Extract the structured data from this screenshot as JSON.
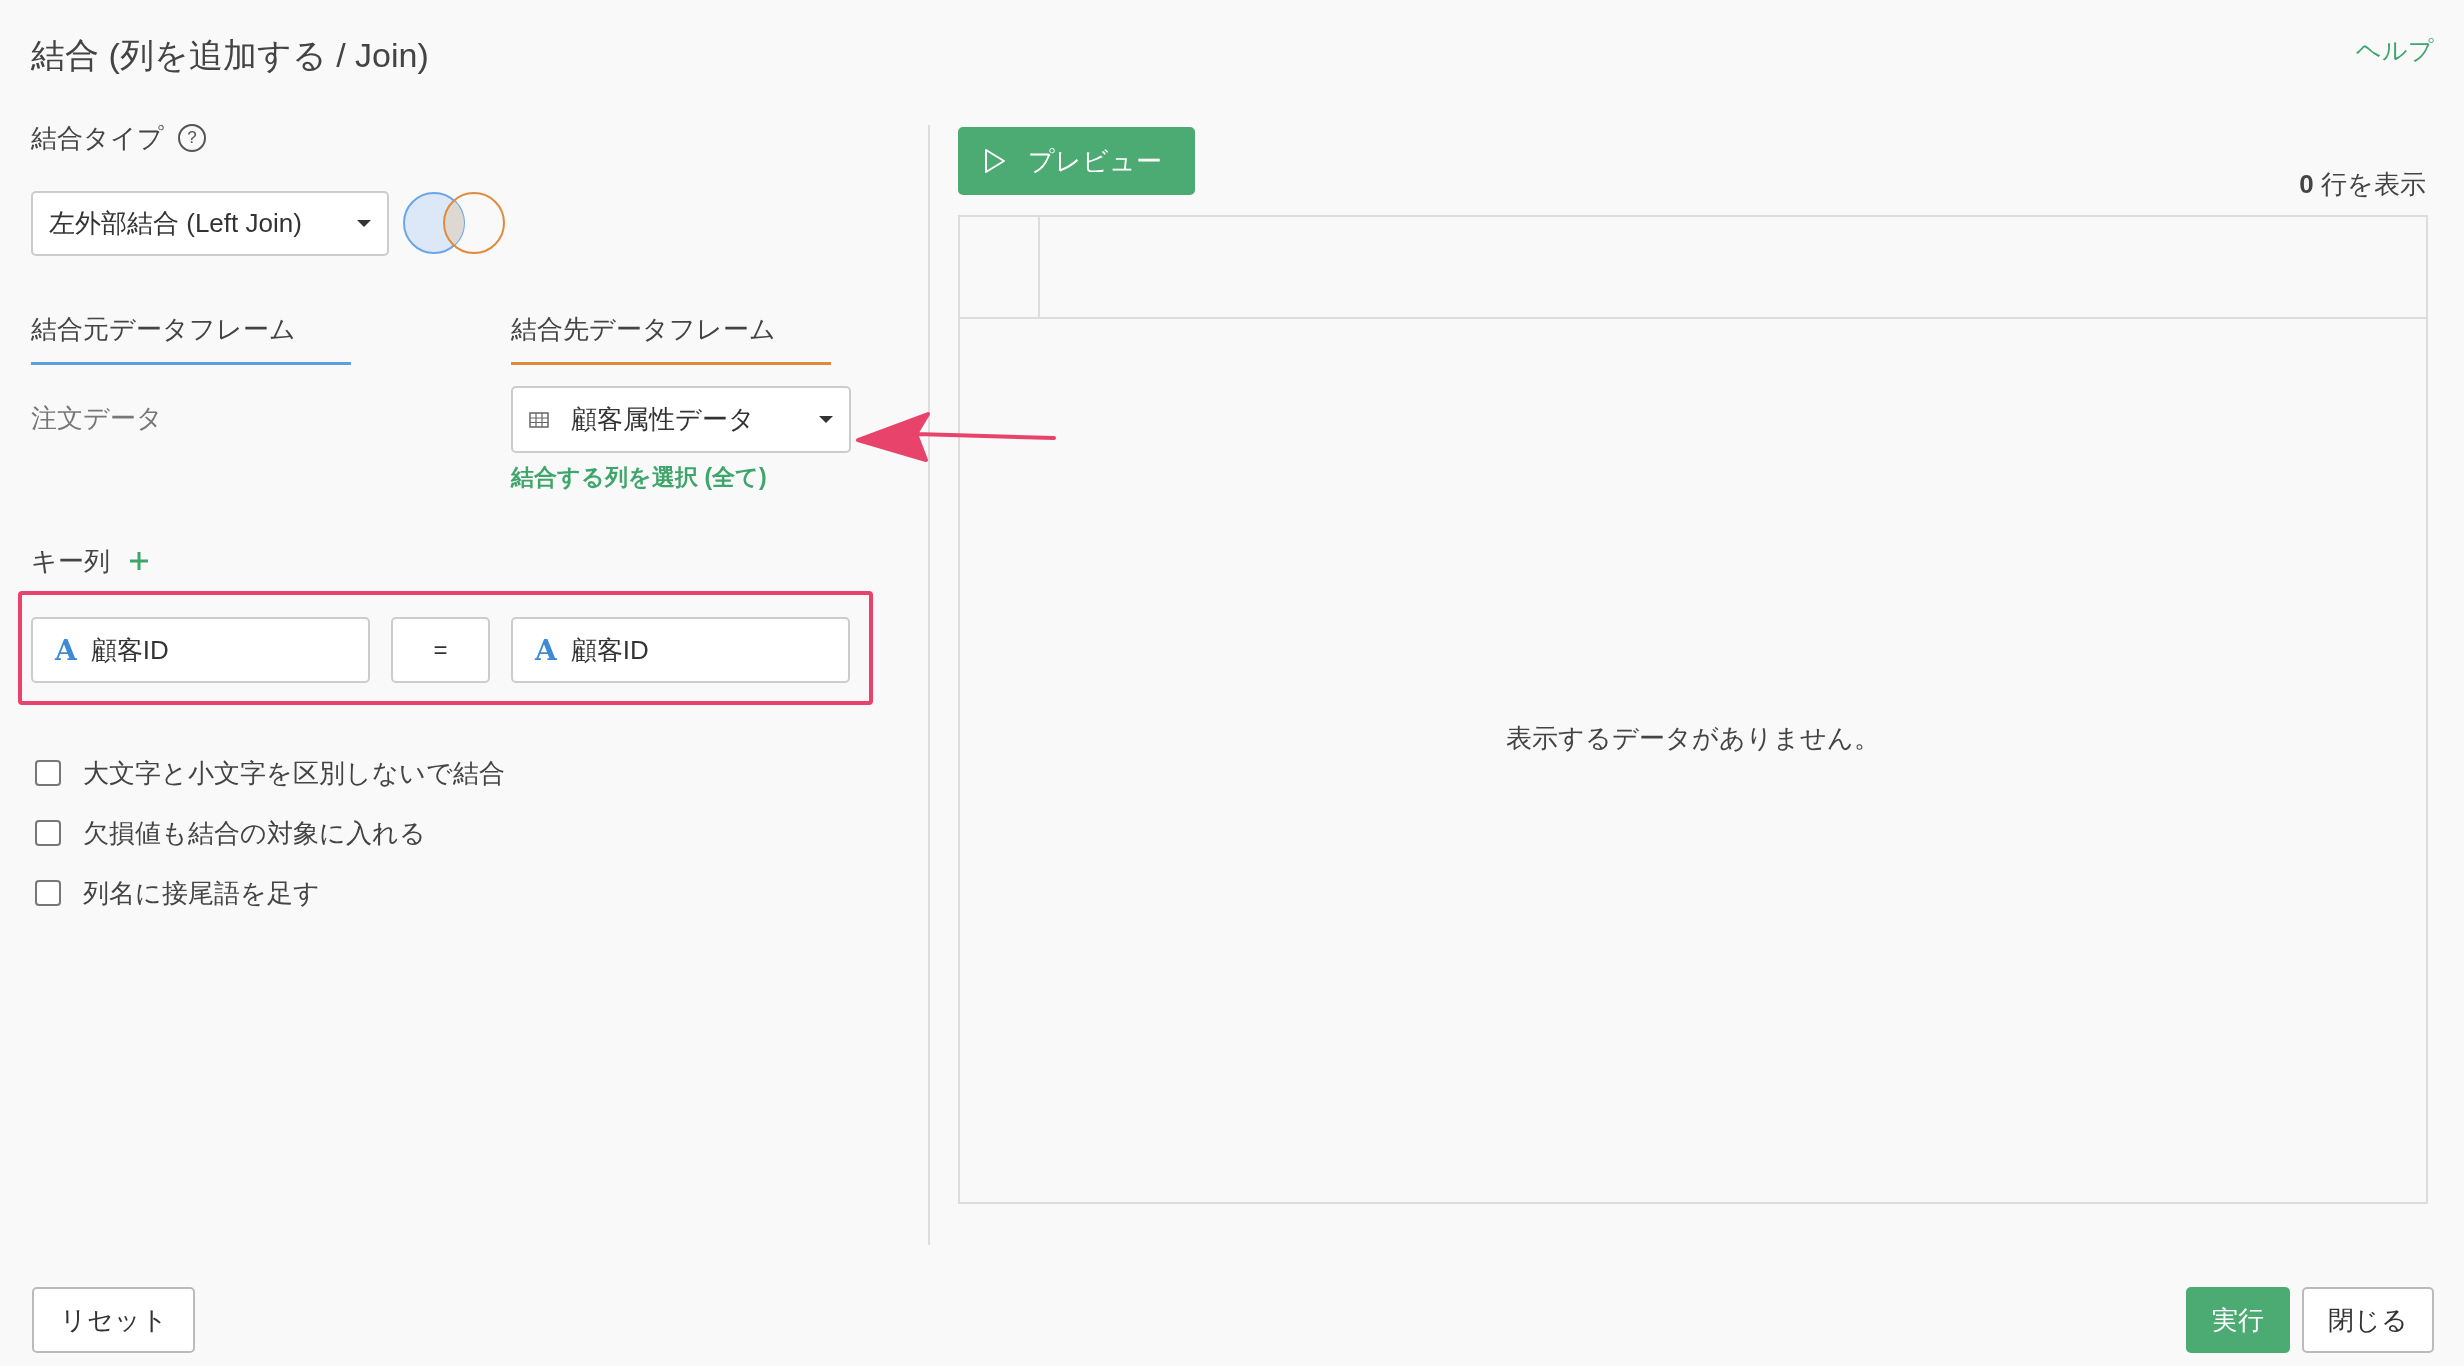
{
  "title": "結合 (列を追加する / Join)",
  "help_link": "ヘルプ",
  "join_type": {
    "label": "結合タイプ",
    "help": "?",
    "value": "左外部結合 (Left Join)"
  },
  "source": {
    "tab": "結合元データフレーム",
    "name": "注文データ"
  },
  "target": {
    "tab": "結合先データフレーム",
    "value": "顧客属性データ",
    "column_link": "結合する列を選択 (全て)"
  },
  "keys": {
    "label": "キー列",
    "pairs": [
      {
        "left_type": "A",
        "left": "顧客ID",
        "operator": "=",
        "right_type": "A",
        "right": "顧客ID"
      }
    ],
    "highlighted": true
  },
  "options": [
    {
      "label": "大文字と小文字を区別しないで結合",
      "checked": false
    },
    {
      "label": "欠損値も結合の対象に入れる",
      "checked": false
    },
    {
      "label": "列名に接尾語を足す",
      "checked": false
    }
  ],
  "preview": {
    "button": "プレビュー",
    "row_count": "**0** 行を表示",
    "empty_message": "表示するデータがありません。"
  },
  "annotation_arrow": true,
  "footer": {
    "reset": "リセット",
    "run": "実行",
    "close": "閉じる"
  }
}
